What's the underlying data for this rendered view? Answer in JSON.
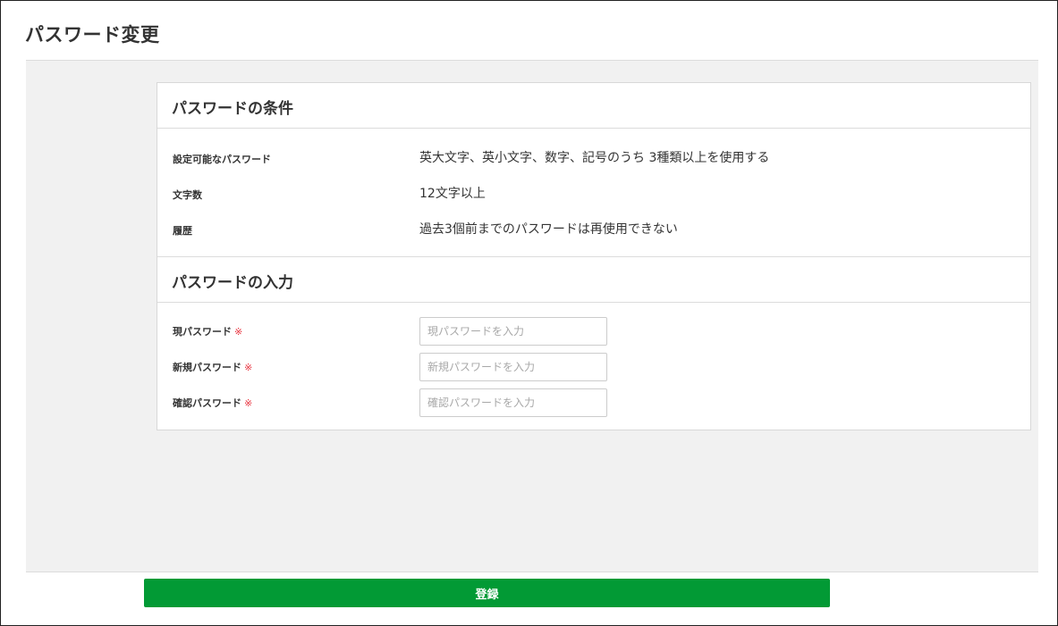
{
  "page": {
    "title": "パスワード変更"
  },
  "conditions": {
    "heading": "パスワードの条件",
    "rows": [
      {
        "label": "設定可能なパスワード",
        "value": "英大文字、英小文字、数字、記号のうち 3種類以上を使用する"
      },
      {
        "label": "文字数",
        "value": "12文字以上"
      },
      {
        "label": "履歴",
        "value": "過去3個前までのパスワードは再使用できない"
      }
    ]
  },
  "input_section": {
    "heading": "パスワードの入力",
    "required_mark": "※",
    "fields": [
      {
        "label": "現パスワード",
        "placeholder": "現パスワードを入力",
        "value": ""
      },
      {
        "label": "新規パスワード",
        "placeholder": "新規パスワードを入力",
        "value": ""
      },
      {
        "label": "確認パスワード",
        "placeholder": "確認パスワードを入力",
        "value": ""
      }
    ]
  },
  "actions": {
    "submit_label": "登録"
  },
  "colors": {
    "primary": "#029a35",
    "required": "#e8333e",
    "background": "#f1f1f1"
  }
}
